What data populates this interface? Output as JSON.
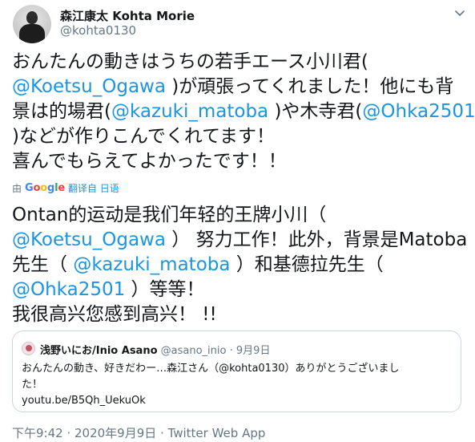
{
  "author": {
    "display_name": "森江康太 Kohta Morie",
    "handle": "@kohta0130"
  },
  "tweet": {
    "lines": [
      [
        {
          "t": "おんたんの動きはうちの若手エース小川君("
        }
      ],
      [
        {
          "t": "@Koetsu_Ogawa",
          "m": true
        },
        {
          "t": " )が頑張ってくれました！他にも背"
        }
      ],
      [
        {
          "t": "景は的場君("
        },
        {
          "t": "@kazuki_matoba",
          "m": true
        },
        {
          "t": " )や木寺君("
        },
        {
          "t": "@Ohka2501",
          "m": true
        }
      ],
      [
        {
          "t": " )などが作りこんでくれてます！"
        }
      ],
      [
        {
          "t": "喜んでもらえてよかったです！！"
        }
      ]
    ]
  },
  "translation": {
    "prefix": "由",
    "provider": "Google",
    "link_label": "翻译自 日语"
  },
  "translated": {
    "lines": [
      [
        {
          "t": "Ontan的运动是我们年轻的王牌小川（"
        }
      ],
      [
        {
          "t": "@Koetsu_Ogawa",
          "m": true
        },
        {
          "t": " ） 努力工作！此外，背景是Matoba"
        }
      ],
      [
        {
          "t": "先生（ "
        },
        {
          "t": "@kazuki_matoba",
          "m": true
        },
        {
          "t": " ）和基德拉先生（"
        }
      ],
      [
        {
          "t": "@Ohka2501",
          "m": true
        },
        {
          "t": " ）等等！"
        }
      ],
      [
        {
          "t": "我很高兴您感到高兴！ !!"
        }
      ]
    ]
  },
  "quote": {
    "name": "浅野いにお/Inio Asano",
    "handle": "@asano_inio",
    "separator": "·",
    "date": "9月9日",
    "lines": [
      "おんたんの動き、好きだわー…森江さん（@kohta0130）ありがとうございまし",
      "た！",
      "youtu.be/B5Qh_UekuOk"
    ]
  },
  "meta": {
    "text": "下午9:42 · 2020年9月9日 · Twitter Web App"
  },
  "icons": {
    "caret": "chevron-down-icon"
  },
  "colors": {
    "mention": "#1b95e0",
    "secondary": "#657786",
    "border": "#ccd6dd"
  }
}
